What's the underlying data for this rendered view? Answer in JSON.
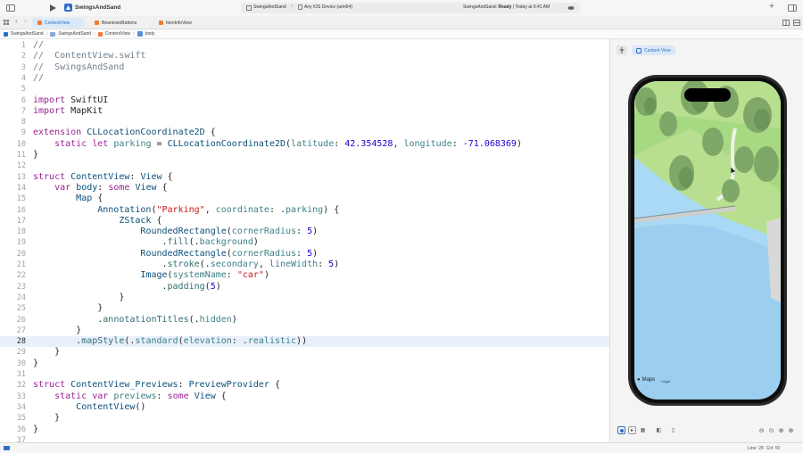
{
  "toolbar": {
    "project_name": "SwingsAndSand",
    "scheme": "SwingsAndSand",
    "destination": "Any iOS Device (arm64)",
    "status_prefix": "SwingsAndSand: ",
    "status_state": "Ready",
    "status_time": " | Today at 9:41 AM"
  },
  "tabs": [
    {
      "label": "ContentView",
      "active": true
    },
    {
      "label": "BeantownButtons",
      "active": false
    },
    {
      "label": "ItemInfoView",
      "active": false
    }
  ],
  "breadcrumb": [
    "SwingsAndSand",
    "SwingsAndSand",
    "ContentView",
    "body"
  ],
  "editor": {
    "current_line": 28,
    "lines": [
      [
        [
          "cm",
          "//"
        ]
      ],
      [
        [
          "cm",
          "//  ContentView.swift"
        ]
      ],
      [
        [
          "cm",
          "//  SwingsAndSand"
        ]
      ],
      [
        [
          "cm",
          "//"
        ]
      ],
      [],
      [
        [
          "kw",
          "import"
        ],
        [
          "",
          " SwiftUI"
        ]
      ],
      [
        [
          "kw",
          "import"
        ],
        [
          "",
          " MapKit"
        ]
      ],
      [],
      [
        [
          "kw",
          "extension"
        ],
        [
          "",
          " "
        ],
        [
          "ty",
          "CLLocationCoordinate2D"
        ],
        [
          "",
          " {"
        ]
      ],
      [
        [
          "",
          "    "
        ],
        [
          "kw",
          "static let"
        ],
        [
          "",
          " "
        ],
        [
          "pr",
          "parking"
        ],
        [
          "",
          " = "
        ],
        [
          "ty",
          "CLLocationCoordinate2D"
        ],
        [
          "",
          "("
        ],
        [
          "pr",
          "latitude"
        ],
        [
          "",
          ": "
        ],
        [
          "nu",
          "42.354528"
        ],
        [
          "",
          ", "
        ],
        [
          "pr",
          "longitude"
        ],
        [
          "",
          ": "
        ],
        [
          "nu",
          "-71.068369"
        ],
        [
          "",
          ")"
        ]
      ],
      [
        [
          "",
          "}"
        ]
      ],
      [],
      [
        [
          "kw",
          "struct"
        ],
        [
          "",
          " "
        ],
        [
          "ty",
          "ContentView"
        ],
        [
          "",
          ": "
        ],
        [
          "ty",
          "View"
        ],
        [
          "",
          " {"
        ]
      ],
      [
        [
          "",
          "    "
        ],
        [
          "kw",
          "var"
        ],
        [
          "",
          " "
        ],
        [
          "ty",
          "body"
        ],
        [
          "",
          ": "
        ],
        [
          "kw",
          "some"
        ],
        [
          "",
          " "
        ],
        [
          "ty",
          "View"
        ],
        [
          "",
          " {"
        ]
      ],
      [
        [
          "",
          "        "
        ],
        [
          "ty",
          "Map"
        ],
        [
          "",
          " {"
        ]
      ],
      [
        [
          "",
          "            "
        ],
        [
          "ty",
          "Annotation"
        ],
        [
          "",
          "("
        ],
        [
          "st",
          "\"Parking\""
        ],
        [
          "",
          ", "
        ],
        [
          "pr",
          "coordinate"
        ],
        [
          "",
          ": ."
        ],
        [
          "pr",
          "parking"
        ],
        [
          "",
          ") {"
        ]
      ],
      [
        [
          "",
          "                "
        ],
        [
          "ty",
          "ZStack"
        ],
        [
          "",
          " {"
        ]
      ],
      [
        [
          "",
          "                    "
        ],
        [
          "ty",
          "RoundedRectangle"
        ],
        [
          "",
          "("
        ],
        [
          "pr",
          "cornerRadius"
        ],
        [
          "",
          ": "
        ],
        [
          "nu",
          "5"
        ],
        [
          "",
          ")"
        ]
      ],
      [
        [
          "",
          "                        ."
        ],
        [
          "fn",
          "fill"
        ],
        [
          "",
          "(."
        ],
        [
          "pr",
          "background"
        ],
        [
          "",
          ")"
        ]
      ],
      [
        [
          "",
          "                    "
        ],
        [
          "ty",
          "RoundedRectangle"
        ],
        [
          "",
          "("
        ],
        [
          "pr",
          "cornerRadius"
        ],
        [
          "",
          ": "
        ],
        [
          "nu",
          "5"
        ],
        [
          "",
          ")"
        ]
      ],
      [
        [
          "",
          "                        ."
        ],
        [
          "fn",
          "stroke"
        ],
        [
          "",
          "(."
        ],
        [
          "pr",
          "secondary"
        ],
        [
          "",
          ", "
        ],
        [
          "pr",
          "lineWidth"
        ],
        [
          "",
          ": "
        ],
        [
          "nu",
          "5"
        ],
        [
          "",
          ")"
        ]
      ],
      [
        [
          "",
          "                    "
        ],
        [
          "ty",
          "Image"
        ],
        [
          "",
          "("
        ],
        [
          "pr",
          "systemName"
        ],
        [
          "",
          ": "
        ],
        [
          "st",
          "\"car\""
        ],
        [
          "",
          ")"
        ]
      ],
      [
        [
          "",
          "                        ."
        ],
        [
          "fn",
          "padding"
        ],
        [
          "",
          "("
        ],
        [
          "nu",
          "5"
        ],
        [
          "",
          ")"
        ]
      ],
      [
        [
          "",
          "                }"
        ]
      ],
      [
        [
          "",
          "            }"
        ]
      ],
      [
        [
          "",
          "            ."
        ],
        [
          "fn",
          "annotationTitles"
        ],
        [
          "",
          "(."
        ],
        [
          "pr",
          "hidden"
        ],
        [
          "",
          ")"
        ]
      ],
      [
        [
          "",
          "        }"
        ]
      ],
      [
        [
          "",
          "        ."
        ],
        [
          "fn",
          "mapStyle"
        ],
        [
          "",
          "(."
        ],
        [
          "pr",
          "standard"
        ],
        [
          "",
          "("
        ],
        [
          "pr",
          "elevation"
        ],
        [
          "",
          ": ."
        ],
        [
          "pr",
          "realistic"
        ],
        [
          "",
          "))"
        ]
      ],
      [
        [
          "",
          "    }"
        ]
      ],
      [
        [
          "",
          "}"
        ]
      ],
      [],
      [
        [
          "kw",
          "struct"
        ],
        [
          "",
          " "
        ],
        [
          "ty",
          "ContentView_Previews"
        ],
        [
          "",
          ": "
        ],
        [
          "ty",
          "PreviewProvider"
        ],
        [
          "",
          " {"
        ]
      ],
      [
        [
          "",
          "    "
        ],
        [
          "kw",
          "static var"
        ],
        [
          "",
          " "
        ],
        [
          "pr",
          "previews"
        ],
        [
          "",
          ": "
        ],
        [
          "kw",
          "some"
        ],
        [
          "",
          " "
        ],
        [
          "ty",
          "View"
        ],
        [
          "",
          " {"
        ]
      ],
      [
        [
          "",
          "        "
        ],
        [
          "ty",
          "ContentView"
        ],
        [
          "",
          "()"
        ]
      ],
      [
        [
          "",
          "    }"
        ]
      ],
      [
        [
          "",
          "}"
        ]
      ],
      []
    ]
  },
  "preview": {
    "pin_label": "Content View",
    "maps_brand": "Maps",
    "legal_label": "Legal"
  },
  "status": {
    "cursor": "Line: 28  Col: 50"
  },
  "colors": {
    "accent": "#2d6fc9",
    "current_line": "#e9f0fb",
    "keyword": "#9b2393",
    "type": "#0b4f79",
    "string": "#c41a16",
    "number": "#1c00cf",
    "comment": "#707f8c"
  }
}
